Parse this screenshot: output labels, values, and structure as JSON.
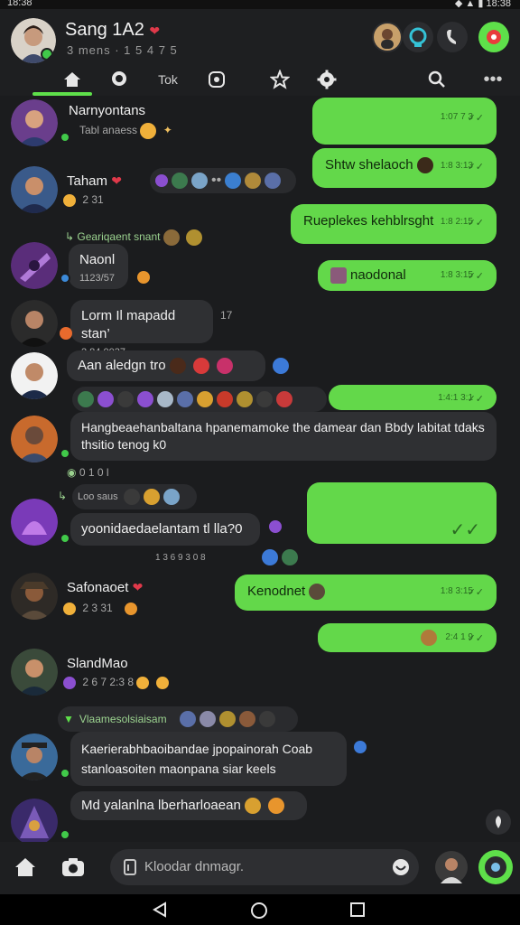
{
  "status": {
    "time": "18:38",
    "right": "◆ ▲ ▮ 18:38"
  },
  "header": {
    "title": "Sang 1A2",
    "subtitle": "3 mens  · 1 5 4 7  5"
  },
  "tabs": [
    {
      "label": ""
    },
    {
      "label": ""
    },
    {
      "label": "Tok"
    },
    {
      "label": ""
    },
    {
      "label": ""
    },
    {
      "label": ""
    }
  ],
  "messages": {
    "m1": {
      "name": "Narnyontans",
      "sub": "Tabl anaess",
      "out": "",
      "time": "1:07 7 3"
    },
    "m2": {
      "out_text": "Shtw shelaoch",
      "time": "1:8 3:13"
    },
    "m3": {
      "name": "Taham",
      "sub": "2 31"
    },
    "m4": {
      "out_text": "Rueplekes kehblrsght",
      "time": "1:8 2:15"
    },
    "m5": {
      "system": "Geariqaent snant"
    },
    "m6": {
      "name": "Naonl",
      "sub": "1123/57"
    },
    "m7": {
      "out_text": "naodonal",
      "time": "1:8 3:15"
    },
    "m8": {
      "text": "Lorm Il mapadd stan’",
      "sub": "2 84 0037",
      "extra": "17"
    },
    "m9": {
      "text": "Aan aledgn  tro"
    },
    "m10": {
      "time": "1:4:1 3:1"
    },
    "m11": {
      "text": "Hangbeaehanbaltana hpanemamoke the damear dan Bbdy labitat tdaks thsitio tenog k0"
    },
    "m12": {
      "sub": "0 1 0 l"
    },
    "m13": {
      "system": "Loo saus"
    },
    "m14": {
      "text": "yoonidaedaelantam  tl lla?0",
      "sub": "1 3 6 9 3 0 8"
    },
    "m15": {
      "name": "Safonaoet",
      "sub": "2 3 31"
    },
    "m16": {
      "out_text": "Kenodnet",
      "time": "1:8 3:15"
    },
    "m17": {
      "time": "2:4 1 9"
    },
    "m18": {
      "name": "SlandMao",
      "sub": "2 6 7 2:3 8"
    },
    "m19": {
      "system": "Vlaamesolsiaisam"
    },
    "m20": {
      "text": "Kaerierabhbaoibandae jpopainorah  Coab",
      "text2": "stanloasoiten  maonpana siar keels"
    },
    "m21": {
      "text": "Md yalanlna lberharloaean"
    }
  },
  "composer": {
    "placeholder": "Kloodar dnmagr."
  },
  "colors": {
    "accent": "#5ee04a",
    "bubble_out": "#63d84a",
    "bubble_in": "#2f3033",
    "bg": "#1b1c1e"
  },
  "icons": [
    "home-icon",
    "camera-icon",
    "star-icon",
    "gear-icon",
    "search-icon",
    "more-icon",
    "send-icon"
  ]
}
